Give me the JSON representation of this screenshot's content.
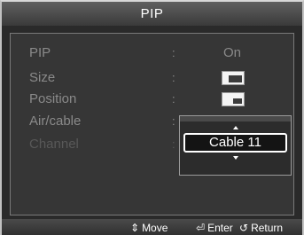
{
  "title": "PIP",
  "menu": {
    "separator": ":",
    "rows": [
      {
        "label": "PIP",
        "value": "On"
      },
      {
        "label": "Size",
        "icon": "pip-size-icon"
      },
      {
        "label": "Position",
        "icon": "pip-position-icon"
      },
      {
        "label": "Air/cable"
      },
      {
        "label": "Channel"
      }
    ]
  },
  "dropdown": {
    "selected": "Cable 11"
  },
  "footer": {
    "move_label": "Move",
    "move_icon": "updown-arrow-icon",
    "move_glyph": "⇕",
    "enter_label": "Enter",
    "enter_icon": "enter-icon",
    "enter_glyph": "⏎",
    "return_label": "Return",
    "return_icon": "return-icon",
    "return_glyph": "↺"
  },
  "colors": {
    "panel": "#363636",
    "text_inactive": "#8a8a8a",
    "text_disabled": "#585858",
    "highlight": "#ffffff"
  }
}
